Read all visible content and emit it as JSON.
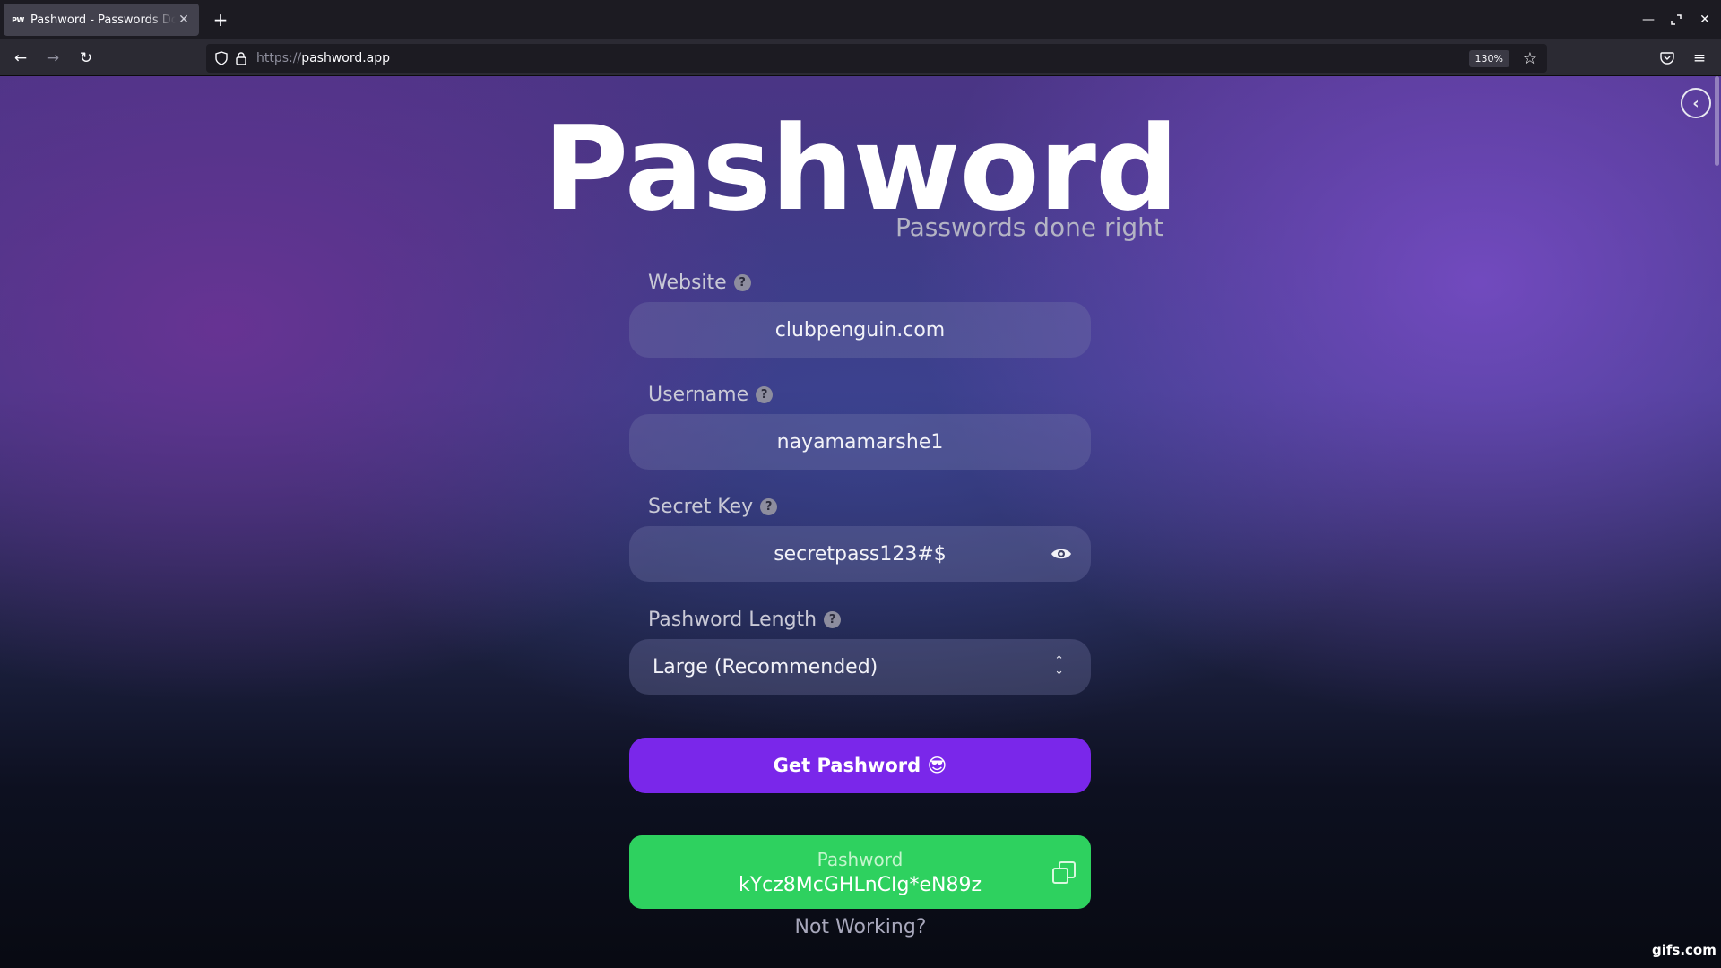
{
  "browser": {
    "tab": {
      "favicon": "PW",
      "title": "Pashword - Passwords Done Right"
    },
    "url": {
      "protocol": "https://",
      "host": "pashword.app"
    },
    "zoom": "130%",
    "icons": [
      "back-icon",
      "forward-icon",
      "reload-icon",
      "shield-icon",
      "lock-icon",
      "star-icon",
      "pocket-icon",
      "menu-icon"
    ]
  },
  "page": {
    "title": "Pashword",
    "tagline": "Passwords done right",
    "fields": {
      "website": {
        "label": "Website",
        "value": "clubpenguin.com"
      },
      "username": {
        "label": "Username",
        "value": "nayamamarshe1"
      },
      "secret_key": {
        "label": "Secret Key",
        "value": "secretpass123#$"
      },
      "length": {
        "label": "Pashword Length",
        "value": "Large (Recommended)"
      }
    },
    "help_glyph": "?",
    "get_button": "Get Pashword 😎",
    "result": {
      "label": "Pashword",
      "value": "kYcz8McGHLnCIg*eN89z"
    },
    "not_working": "Not Working?"
  },
  "watermark": "gifs.com",
  "colors": {
    "accent": "#7a27ea",
    "success": "#2ed15f"
  }
}
